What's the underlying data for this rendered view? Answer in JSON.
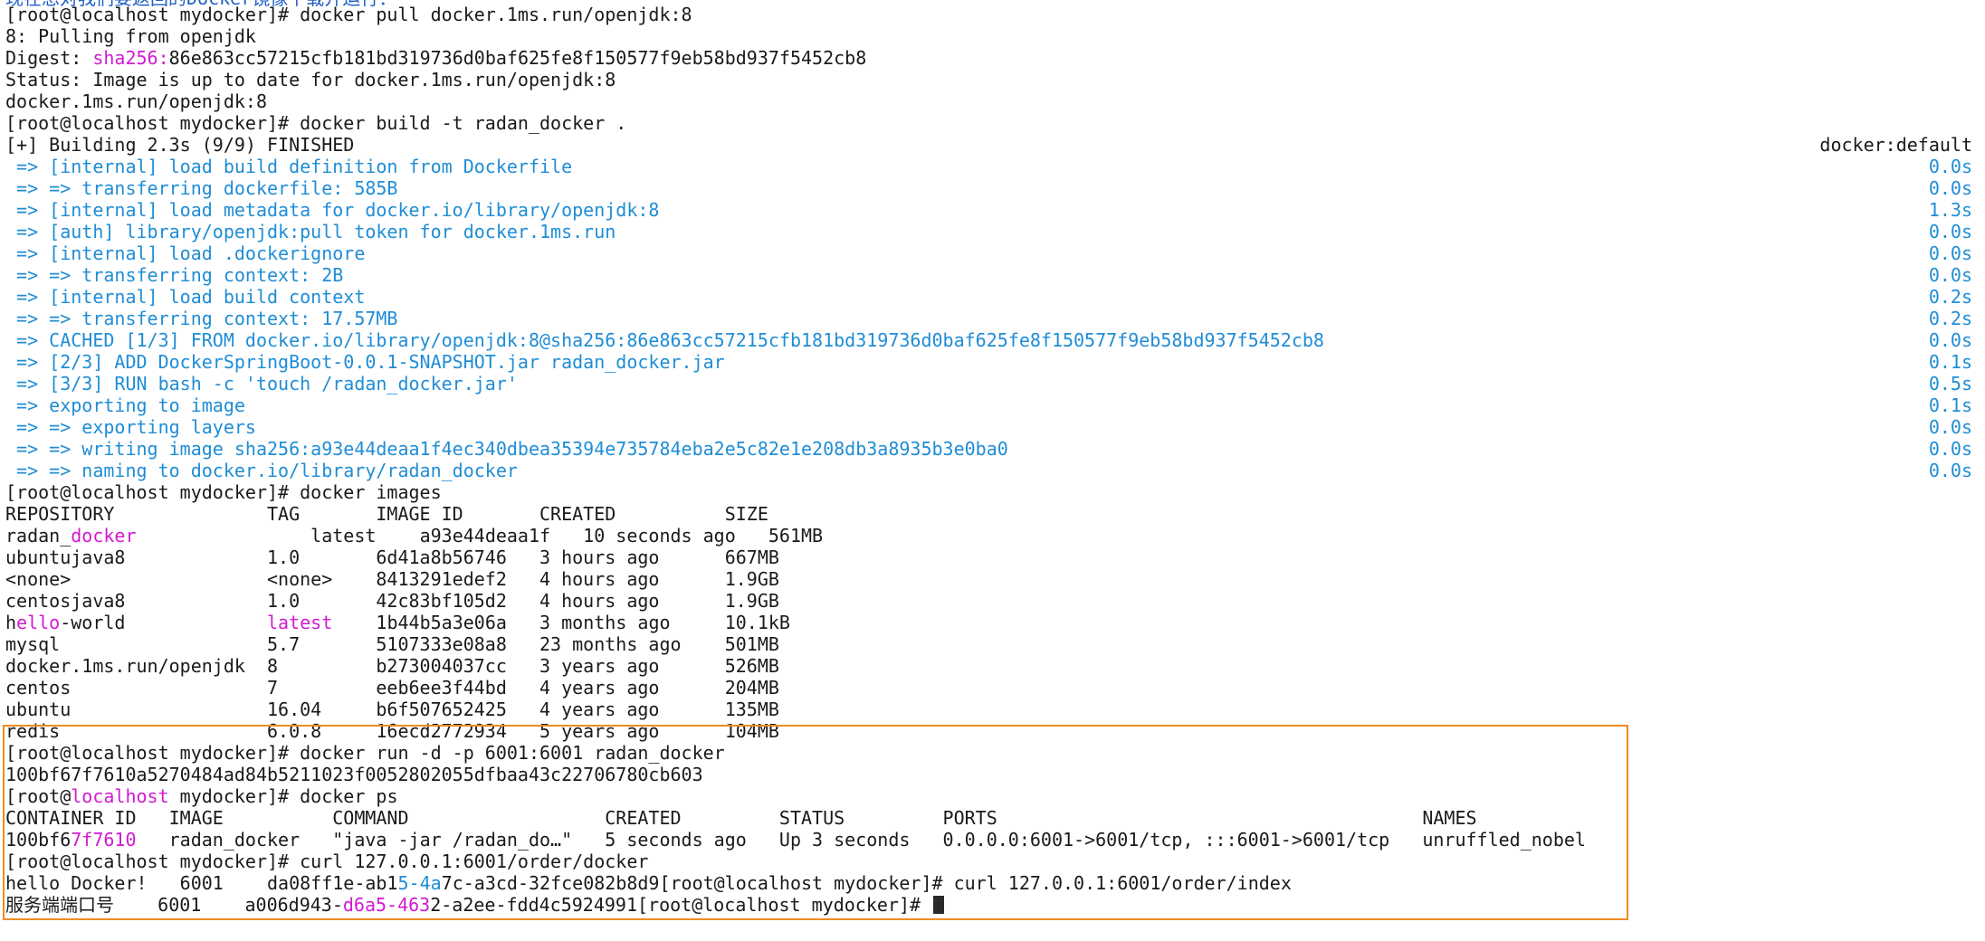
{
  "top_clip": "现在想对我们要返回的Docker镜像下载并运行：",
  "pull": {
    "prompt": "[root@localhost mydocker]# docker pull docker.1ms.run/openjdk:8",
    "pulling": "8: Pulling from openjdk",
    "digest_label": "Digest: ",
    "digest_algo": "sha256:",
    "digest_hash": "86e863cc57215cfb181bd319736d0baf625fe8f150577f9eb58bd937f5452cb8",
    "status": "Status: Image is up to date for docker.1ms.run/openjdk:8",
    "ref": "docker.1ms.run/openjdk:8"
  },
  "build": {
    "prompt": "[root@localhost mydocker]# docker build -t radan_docker .",
    "header": "[+] Building 2.3s (9/9) FINISHED",
    "header_right": "docker:default",
    "steps": [
      {
        "text": " => [internal] load build definition from Dockerfile",
        "dur": "0.0s"
      },
      {
        "text": " => => transferring dockerfile: 585B",
        "dur": "0.0s"
      },
      {
        "text": " => [internal] load metadata for docker.io/library/openjdk:8",
        "dur": "1.3s"
      },
      {
        "text": " => [auth] library/openjdk:pull token for docker.1ms.run",
        "dur": "0.0s"
      },
      {
        "text": " => [internal] load .dockerignore",
        "dur": "0.0s"
      },
      {
        "text": " => => transferring context: 2B",
        "dur": "0.0s"
      },
      {
        "text": " => [internal] load build context",
        "dur": "0.2s"
      },
      {
        "text": " => => transferring context: 17.57MB",
        "dur": "0.2s"
      },
      {
        "text": " => CACHED [1/3] FROM docker.io/library/openjdk:8@sha256:86e863cc57215cfb181bd319736d0baf625fe8f150577f9eb58bd937f5452cb8",
        "dur": "0.0s"
      },
      {
        "text": " => [2/3] ADD DockerSpringBoot-0.0.1-SNAPSHOT.jar radan_docker.jar",
        "dur": "0.1s"
      },
      {
        "text": " => [3/3] RUN bash -c 'touch /radan_docker.jar'",
        "dur": "0.5s"
      },
      {
        "text": " => exporting to image",
        "dur": "0.1s"
      },
      {
        "text": " => => exporting layers",
        "dur": "0.0s"
      },
      {
        "text": " => => writing image sha256:a93e44deaa1f4ec340dbea35394e735784eba2e5c82e1e208db3a8935b3e0ba0",
        "dur": "0.0s"
      },
      {
        "text": " => => naming to docker.io/library/radan_docker",
        "dur": "0.0s"
      }
    ]
  },
  "images": {
    "prompt": "[root@localhost mydocker]# docker images",
    "header": "REPOSITORY              TAG       IMAGE ID       CREATED          SIZE",
    "rows": [
      [
        "radan_",
        "docker",
        "                latest    a93e44deaa1f   10 seconds ago   561MB"
      ],
      [
        "ubuntujava8             1.0       6d41a8b56746   3 hours ago      667MB"
      ],
      [
        "<none>                  <none>    8413291edef2   4 hours ago      1.9GB"
      ],
      [
        "centosjava8             1.0       42c83bf105d2   4 hours ago      1.9GB"
      ],
      [
        "h",
        "ello",
        "-world             ",
        "latest",
        "    1b44b5a3e06a   3 months ago     10.1kB"
      ],
      [
        "mysql                   5.7       5107333e08a8   23 months ago    501MB"
      ],
      [
        "docker.1ms.run/openjdk  8         b273004037cc   3 years ago      526MB"
      ],
      [
        "centos                  7         eeb6ee3f44bd   4 years ago      204MB"
      ],
      [
        "ubuntu                  16.04     b6f507652425   4 years ago      135MB"
      ],
      [
        "redis                   6.0.8     16ecd2772934   5 years ago      104MB"
      ]
    ]
  },
  "run": {
    "prompt": "[root@localhost mydocker]# docker run -d -p 6001:6001 radan_docker",
    "container_hash": "100bf67f7610a5270484ad84b5211023f0052802055dfbaa43c22706780cb603"
  },
  "ps": {
    "prompt_a": "[root@",
    "prompt_host": "localhost",
    "prompt_b": " mydocker]# docker ps",
    "header": "CONTAINER ID   IMAGE          COMMAND                  CREATED         STATUS         PORTS                                       NAMES",
    "row_a": "100bf6",
    "row_mag": "7f7610",
    "row_b": "   radan_docker   \"java -jar /radan_do…\"   5 seconds ago   Up 3 seconds   0.0.0.0:6001->6001/tcp, :::6001->6001/tcp   unruffled_nobel"
  },
  "curl": {
    "prompt1": "[root@localhost mydocker]# curl 127.0.0.1:6001/order/docker",
    "out1_a": "hello Docker!   6001    da08ff1e-ab1",
    "out1_b": "5-4a",
    "out1_c": "7c-a3cd-32fce082b8d9[root@localhost mydocker]# curl 127.0.0.1:6001/order/index",
    "out2_a": "服务端端口号    6001    a006d943-",
    "out2_b": "d6a5-463",
    "out2_c": "2-a2ee-fdd4c5924991[root@localhost mydocker]# "
  },
  "colors": {
    "blue": "#1f8dd6",
    "magenta": "#d11bd1",
    "highlight": "#f08a24"
  }
}
